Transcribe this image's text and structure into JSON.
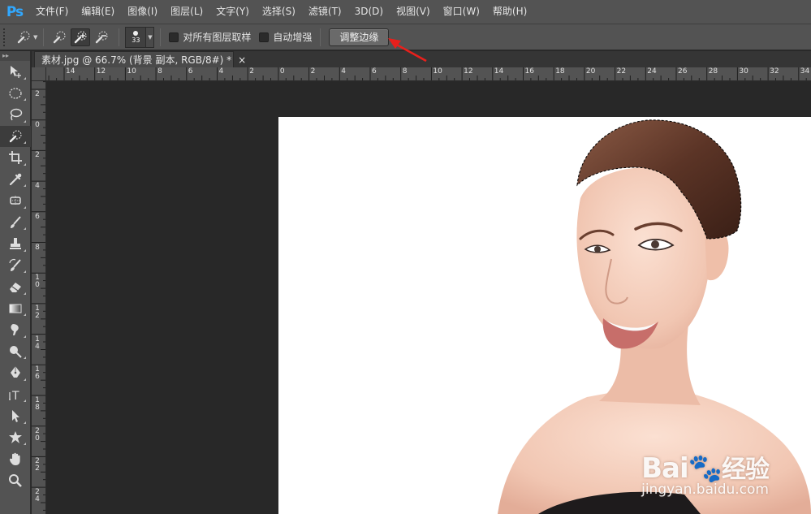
{
  "app": {
    "logo": "Ps"
  },
  "menu": [
    {
      "label": "文件(F)"
    },
    {
      "label": "编辑(E)"
    },
    {
      "label": "图像(I)"
    },
    {
      "label": "图层(L)"
    },
    {
      "label": "文字(Y)"
    },
    {
      "label": "选择(S)"
    },
    {
      "label": "滤镜(T)"
    },
    {
      "label": "3D(D)"
    },
    {
      "label": "视图(V)"
    },
    {
      "label": "窗口(W)"
    },
    {
      "label": "帮助(H)"
    }
  ],
  "options": {
    "brush_size": "33",
    "sample_all_layers_label": "对所有图层取样",
    "sample_all_layers_checked": false,
    "auto_enhance_label": "自动增强",
    "auto_enhance_checked": false,
    "refine_edge_label": "调整边缘"
  },
  "tools_panel": {
    "header": "▸▸"
  },
  "document_tab": {
    "title": "素材.jpg @ 66.7% (背景 副本, RGB/8#) *",
    "close": "×"
  },
  "ruler_top_labels": [
    "14",
    "12",
    "10",
    "8",
    "6",
    "4",
    "2",
    "0",
    "2",
    "4",
    "6",
    "8",
    "10",
    "12",
    "14",
    "16",
    "18",
    "20",
    "22",
    "24",
    "26",
    "28",
    "30",
    "32",
    "34"
  ],
  "ruler_left_labels": [
    "2",
    "0",
    "2",
    "4",
    "6",
    "8",
    "1\n0",
    "1\n2",
    "1\n4",
    "1\n6",
    "1\n8",
    "2\n0",
    "2\n2",
    "2\n4"
  ],
  "watermark": {
    "brand": "Bai",
    "brand_tail": "经验",
    "url": "jingyan.baidu.com"
  },
  "colors": {
    "chrome": "#535353",
    "pasteboard": "#282828",
    "ps_blue": "#31a8ff",
    "annotation_arrow": "#e8201c"
  }
}
